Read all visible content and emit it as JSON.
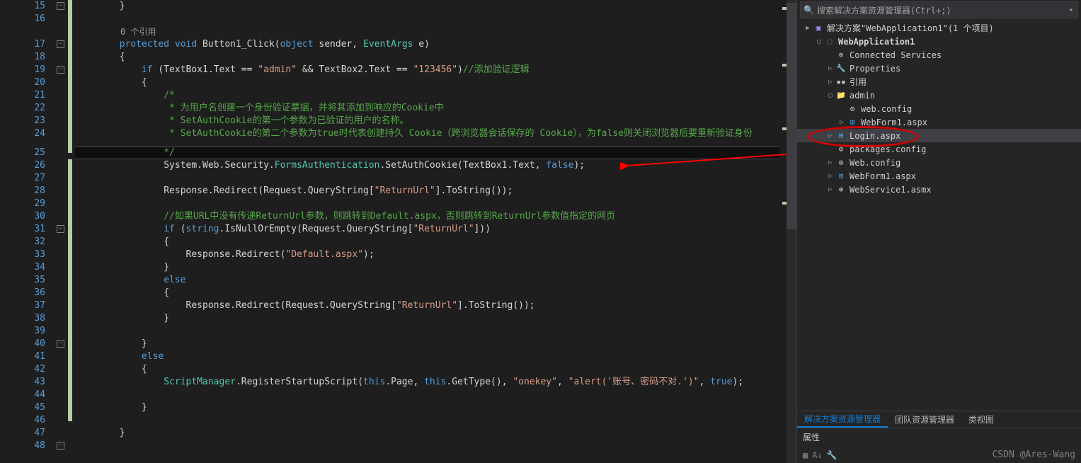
{
  "editor": {
    "first_line_no": 15,
    "codelens": "0 个引用",
    "lines": [
      {
        "no": 15,
        "parts": [
          {
            "c": "tok-plain",
            "t": "        }"
          }
        ]
      },
      {
        "no": 16,
        "parts": []
      },
      {
        "codelens": true
      },
      {
        "no": 17,
        "parts": [
          {
            "c": "tok-kw",
            "t": "        protected"
          },
          {
            "c": "tok-plain",
            "t": " "
          },
          {
            "c": "tok-kw",
            "t": "void"
          },
          {
            "c": "tok-plain",
            "t": " Button1_Click("
          },
          {
            "c": "tok-kw",
            "t": "object"
          },
          {
            "c": "tok-plain",
            "t": " sender, "
          },
          {
            "c": "tok-type",
            "t": "EventArgs"
          },
          {
            "c": "tok-plain",
            "t": " e)"
          }
        ]
      },
      {
        "no": 18,
        "parts": [
          {
            "c": "tok-plain",
            "t": "        {"
          }
        ]
      },
      {
        "no": 19,
        "parts": [
          {
            "c": "tok-plain",
            "t": "            "
          },
          {
            "c": "tok-kw",
            "t": "if"
          },
          {
            "c": "tok-plain",
            "t": " (TextBox1.Text == "
          },
          {
            "c": "tok-str",
            "t": "\"admin\""
          },
          {
            "c": "tok-plain",
            "t": " && TextBox2.Text == "
          },
          {
            "c": "tok-str",
            "t": "\"123456\""
          },
          {
            "c": "tok-plain",
            "t": ")"
          },
          {
            "c": "tok-comment",
            "t": "//添加验证逻辑"
          }
        ]
      },
      {
        "no": 20,
        "parts": [
          {
            "c": "tok-plain",
            "t": "            {"
          }
        ]
      },
      {
        "no": 21,
        "parts": [
          {
            "c": "tok-plain",
            "t": "                "
          },
          {
            "c": "tok-comment",
            "t": "/*"
          }
        ]
      },
      {
        "no": 22,
        "parts": [
          {
            "c": "tok-comment",
            "t": "                 * 为用户名创建一个身份验证票据，并将其添加到响应的Cookie中"
          }
        ]
      },
      {
        "no": 23,
        "parts": [
          {
            "c": "tok-comment",
            "t": "                 * SetAuthCookie的第一个参数为已验证的用户的名称。"
          }
        ]
      },
      {
        "no": 24,
        "parts": [
          {
            "c": "tok-comment",
            "t": "                 * SetAuthCookie的第二个参数为true时代表创建持久 Cookie（跨浏览器会话保存的 Cookie），为false则关闭浏览器后要重新验证身份"
          }
        ]
      },
      {
        "split": true
      },
      {
        "no": 25,
        "hl": true,
        "parts": [
          {
            "c": "tok-plain",
            "t": "                "
          },
          {
            "c": "tok-comment",
            "t": "*/"
          }
        ]
      },
      {
        "no": 26,
        "parts": [
          {
            "c": "tok-plain",
            "t": "                System.Web.Security."
          },
          {
            "c": "tok-type",
            "t": "FormsAuthentication"
          },
          {
            "c": "tok-plain",
            "t": ".SetAuthCookie(TextBox1.Text, "
          },
          {
            "c": "tok-kw",
            "t": "false"
          },
          {
            "c": "tok-plain",
            "t": ");"
          }
        ]
      },
      {
        "no": 27,
        "parts": []
      },
      {
        "no": 28,
        "parts": [
          {
            "c": "tok-plain",
            "t": "                Response.Redirect(Request.QueryString["
          },
          {
            "c": "tok-str",
            "t": "\"ReturnUrl\""
          },
          {
            "c": "tok-plain",
            "t": "].ToString());"
          }
        ]
      },
      {
        "no": 29,
        "parts": []
      },
      {
        "no": 30,
        "parts": [
          {
            "c": "tok-plain",
            "t": "                "
          },
          {
            "c": "tok-comment",
            "t": "//如果URL中没有传递ReturnUrl参数，则跳转到Default.aspx，否则跳转到ReturnUrl参数值指定的网页"
          }
        ]
      },
      {
        "no": 31,
        "parts": [
          {
            "c": "tok-plain",
            "t": "                "
          },
          {
            "c": "tok-kw",
            "t": "if"
          },
          {
            "c": "tok-plain",
            "t": " ("
          },
          {
            "c": "tok-kw",
            "t": "string"
          },
          {
            "c": "tok-plain",
            "t": ".IsNullOrEmpty(Request.QueryString["
          },
          {
            "c": "tok-str",
            "t": "\"ReturnUrl\""
          },
          {
            "c": "tok-plain",
            "t": "]))"
          }
        ]
      },
      {
        "no": 32,
        "parts": [
          {
            "c": "tok-plain",
            "t": "                {"
          }
        ]
      },
      {
        "no": 33,
        "parts": [
          {
            "c": "tok-plain",
            "t": "                    Response.Redirect("
          },
          {
            "c": "tok-str",
            "t": "\"Default.aspx\""
          },
          {
            "c": "tok-plain",
            "t": ");"
          }
        ]
      },
      {
        "no": 34,
        "parts": [
          {
            "c": "tok-plain",
            "t": "                }"
          }
        ]
      },
      {
        "no": 35,
        "parts": [
          {
            "c": "tok-plain",
            "t": "                "
          },
          {
            "c": "tok-kw",
            "t": "else"
          }
        ]
      },
      {
        "no": 36,
        "parts": [
          {
            "c": "tok-plain",
            "t": "                {"
          }
        ]
      },
      {
        "no": 37,
        "parts": [
          {
            "c": "tok-plain",
            "t": "                    Response.Redirect(Request.QueryString["
          },
          {
            "c": "tok-str",
            "t": "\"ReturnUrl\""
          },
          {
            "c": "tok-plain",
            "t": "].ToString());"
          }
        ]
      },
      {
        "no": 38,
        "parts": [
          {
            "c": "tok-plain",
            "t": "                }"
          }
        ]
      },
      {
        "no": 39,
        "parts": []
      },
      {
        "no": 40,
        "parts": [
          {
            "c": "tok-plain",
            "t": "            }"
          }
        ]
      },
      {
        "no": 41,
        "parts": [
          {
            "c": "tok-plain",
            "t": "            "
          },
          {
            "c": "tok-kw",
            "t": "else"
          }
        ]
      },
      {
        "no": 42,
        "parts": [
          {
            "c": "tok-plain",
            "t": "            {"
          }
        ]
      },
      {
        "no": 43,
        "parts": [
          {
            "c": "tok-plain",
            "t": "                "
          },
          {
            "c": "tok-type",
            "t": "ScriptManager"
          },
          {
            "c": "tok-plain",
            "t": ".RegisterStartupScript("
          },
          {
            "c": "tok-kw",
            "t": "this"
          },
          {
            "c": "tok-plain",
            "t": ".Page, "
          },
          {
            "c": "tok-kw",
            "t": "this"
          },
          {
            "c": "tok-plain",
            "t": ".GetType(), "
          },
          {
            "c": "tok-str",
            "t": "\"onekey\""
          },
          {
            "c": "tok-plain",
            "t": ", "
          },
          {
            "c": "tok-str",
            "t": "\"alert('账号、密码不对.')\""
          },
          {
            "c": "tok-plain",
            "t": ", "
          },
          {
            "c": "tok-kw",
            "t": "true"
          },
          {
            "c": "tok-plain",
            "t": ");"
          }
        ]
      },
      {
        "no": 44,
        "parts": []
      },
      {
        "no": 45,
        "parts": [
          {
            "c": "tok-plain",
            "t": "            }"
          }
        ]
      },
      {
        "no": 46,
        "parts": []
      },
      {
        "no": 47,
        "parts": [
          {
            "c": "tok-plain",
            "t": "        }"
          }
        ]
      },
      {
        "no": 48,
        "parts": []
      }
    ]
  },
  "solution": {
    "search_placeholder": "搜索解决方案资源管理器(Ctrl+;)",
    "root": "解决方案\"WebApplication1\"(1 个项目)",
    "tree": [
      {
        "depth": 0,
        "tw": "▶",
        "ico": "sol",
        "txt": "解决方案\"WebApplication1\"(1 个项目)",
        "int": true,
        "name": "solution-root"
      },
      {
        "depth": 1,
        "tw": "▢",
        "ico": "proj",
        "txt": "WebApplication1",
        "bold": true,
        "int": true,
        "name": "project-node"
      },
      {
        "depth": 2,
        "tw": "",
        "ico": "glb",
        "txt": "Connected Services",
        "int": true,
        "name": "connected-services"
      },
      {
        "depth": 2,
        "tw": "▷",
        "ico": "prop",
        "txt": "Properties",
        "int": true,
        "name": "properties-node"
      },
      {
        "depth": 2,
        "tw": "▷",
        "ico": "ref",
        "txt": "引用",
        "int": true,
        "name": "references-node"
      },
      {
        "depth": 2,
        "tw": "▢",
        "ico": "fldr",
        "txt": "admin",
        "int": true,
        "name": "folder-admin"
      },
      {
        "depth": 3,
        "tw": "",
        "ico": "cfg",
        "txt": "web.config",
        "int": true,
        "name": "file-admin-webconfig"
      },
      {
        "depth": 3,
        "tw": "▷",
        "ico": "aspx",
        "txt": "WebForm1.aspx",
        "int": true,
        "name": "file-admin-webform1"
      },
      {
        "depth": 2,
        "tw": "▷",
        "ico": "aspx",
        "txt": "Login.aspx",
        "sel": true,
        "int": true,
        "name": "file-login-aspx"
      },
      {
        "depth": 2,
        "tw": "",
        "ico": "cfg",
        "txt": "packages.config",
        "int": true,
        "name": "file-packages-config"
      },
      {
        "depth": 2,
        "tw": "▷",
        "ico": "cfg",
        "txt": "Web.config",
        "int": true,
        "name": "file-web-config"
      },
      {
        "depth": 2,
        "tw": "▷",
        "ico": "aspx",
        "txt": "WebForm1.aspx",
        "int": true,
        "name": "file-webform1"
      },
      {
        "depth": 2,
        "tw": "▷",
        "ico": "svc",
        "txt": "WebService1.asmx",
        "int": true,
        "name": "file-webservice1"
      }
    ]
  },
  "tabs": {
    "t0": "解决方案资源管理器",
    "t1": "团队资源管理器",
    "t2": "类视图"
  },
  "props": {
    "title": "属性",
    "watermark": "CSDN @Ares-Wang"
  }
}
